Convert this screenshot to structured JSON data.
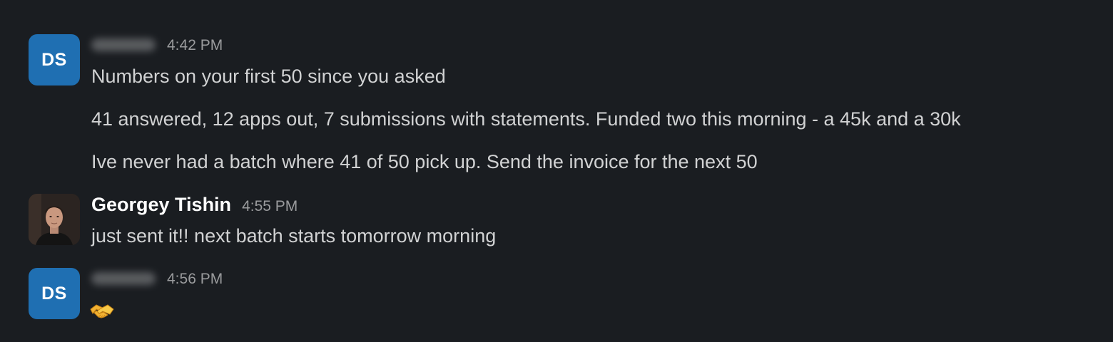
{
  "messages": [
    {
      "avatar_initials": "DS",
      "sender": "",
      "time": "4:42 PM",
      "lines": [
        "Numbers on your first 50 since you asked",
        "41 answered, 12 apps out, 7 submissions with statements. Funded two this morning - a 45k and a 30k",
        "Ive never had a batch where 41 of 50 pick up. Send the invoice for the next 50"
      ]
    },
    {
      "avatar": "photo",
      "sender": "Georgey Tishin",
      "time": "4:55 PM",
      "lines": [
        "just sent it!! next batch starts tomorrow morning"
      ]
    },
    {
      "avatar_initials": "DS",
      "sender": "",
      "time": "4:56 PM",
      "lines": [],
      "emoji": "handshake-emoji"
    }
  ],
  "colors": {
    "background": "#1a1d21",
    "avatar_blue": "#1f6fb2",
    "text": "#d1d2d3",
    "timestamp": "#9a9b9d",
    "name": "#ffffff"
  }
}
